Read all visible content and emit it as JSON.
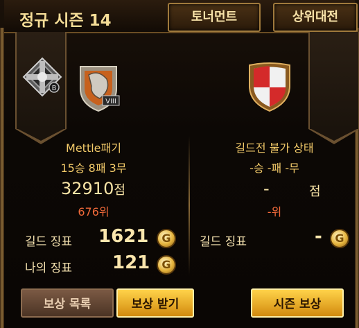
{
  "header": {
    "title": "정규 시즌 14",
    "tabs": {
      "tournament": "토너먼트",
      "ranking": "상위대전"
    }
  },
  "left": {
    "guild_name": "Mettle패기",
    "record": "15승 8패 3무",
    "score": "32910",
    "score_unit": "점",
    "rank": "676위",
    "guild_token_label": "길드 징표",
    "guild_token_value": "1621",
    "my_token_label": "나의 징표",
    "my_token_value": "121",
    "rank_badge": "VIII",
    "tier_letter": "B"
  },
  "right": {
    "status": "길드전 불가 상태",
    "record": "-승 -패 -무",
    "score": "-",
    "score_unit": "점",
    "rank": "-위",
    "guild_token_label": "길드 징표",
    "guild_token_value": "-"
  },
  "coin_glyph": "G",
  "buttons": {
    "reward_list": "보상 목록",
    "claim_reward": "보상 받기",
    "season_reward": "시즌 보상"
  },
  "colors": {
    "gold_text": "#f4cb6a",
    "rank_text": "#f26a3a",
    "button_gold": "#ffd34a"
  }
}
